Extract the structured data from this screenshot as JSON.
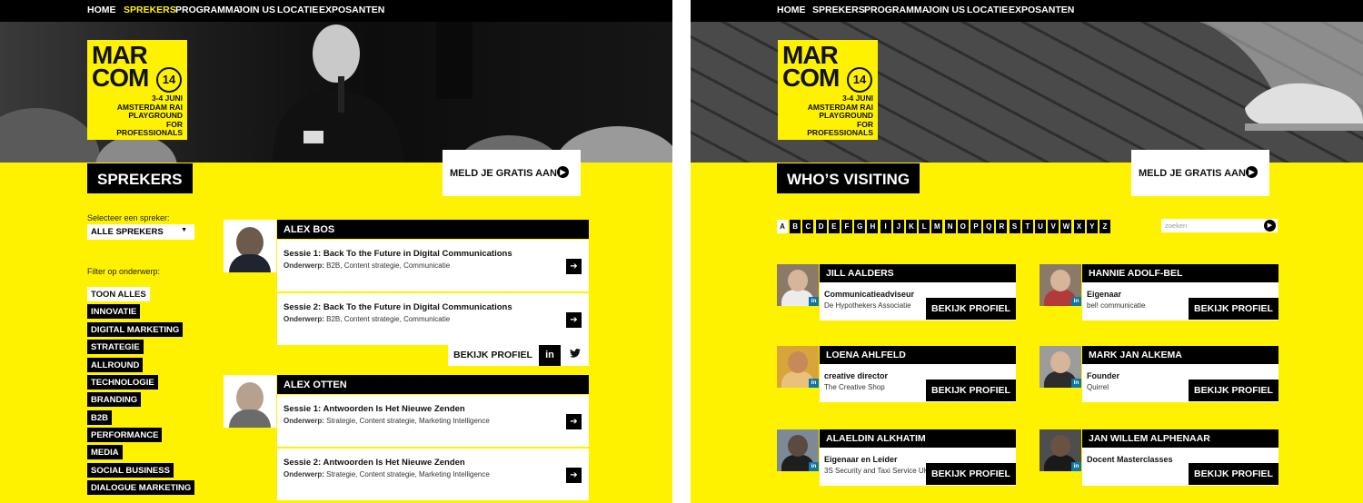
{
  "nav": [
    "HOME",
    "SPREKERS",
    "PROGRAMMA",
    "JOIN US",
    "LOCATIE",
    "EXPOSANTEN"
  ],
  "logo": {
    "line1": "MAR",
    "line2": "COM",
    "edition": "14",
    "dates": "3-4 JUNI",
    "venue": "AMSTERDAM RAI",
    "tag1": "PLAYGROUND",
    "tag2": "FOR",
    "tag3": "PROFESSIONALS"
  },
  "cta_label": "MELD JE GRATIS AAN",
  "left": {
    "title": "SPREKERS",
    "select_label": "Selecteer een spreker:",
    "select_value": "ALLE SPREKERS",
    "filter_label": "Filter op onderwerp:",
    "filters": [
      "TOON ALLES",
      "INNOVATIE",
      "DIGITAL MARKETING",
      "STRATEGIE",
      "ALLROUND",
      "TECHNOLOGIE",
      "BRANDING",
      "B2B",
      "PERFORMANCE",
      "MEDIA",
      "SOCIAL BUSINESS",
      "DIALOGUE MARKETING"
    ],
    "subject_prefix": "Onderwerp:",
    "speakers": [
      {
        "name": "ALEX BOS",
        "sessions": [
          {
            "title": "Sessie 1: Back To the Future in Digital Communications",
            "subjects": "B2B, Content strategie, Communicatie"
          },
          {
            "title": "Sessie 2: Back To the Future in Digital Communications",
            "subjects": "B2B, Content strategie, Communicatie"
          }
        ]
      },
      {
        "name": "ALEX OTTEN",
        "sessions": [
          {
            "title": "Sessie 1: Antwoorden Is Het Nieuwe Zenden",
            "subjects": "Strategie, Content strategie, Marketing Intelligence"
          },
          {
            "title": "Sessie 2: Antwoorden Is Het Nieuwe Zenden",
            "subjects": "Strategie, Content strategie, Marketing Intelligence"
          }
        ]
      }
    ],
    "profile_label": "BEKIJK PROFIEL",
    "linkedin_label": "in"
  },
  "right": {
    "title": "WHO’S VISITING",
    "letters": [
      "A",
      "B",
      "C",
      "D",
      "E",
      "F",
      "G",
      "H",
      "I",
      "J",
      "K",
      "L",
      "M",
      "N",
      "O",
      "P",
      "Q",
      "R",
      "S",
      "T",
      "U",
      "V",
      "W",
      "X",
      "Y",
      "Z"
    ],
    "search_placeholder": "zoeken",
    "linkedin_label": "in",
    "profile_label": "BEKIJK PROFIEL",
    "visitors": [
      {
        "name": "JILL AALDERS",
        "role": "Communicatieadviseur",
        "org": "De Hypothekers Associatie"
      },
      {
        "name": "HANNIE ADOLF-BEL",
        "role": "Eigenaar",
        "org": "bel! communicatie"
      },
      {
        "name": "LOENA AHLFELD",
        "role": "creative director",
        "org": "The Creative Shop"
      },
      {
        "name": "MARK JAN ALKEMA",
        "role": "Founder",
        "org": "Quirrel"
      },
      {
        "name": "ALAELDIN ALKHATIM",
        "role": "Eigenaar en Leider",
        "org": "3S Security and Taxi Service UK"
      },
      {
        "name": "JAN WILLEM ALPHENAAR",
        "role": "Docent Masterclasses",
        "org": ""
      }
    ]
  },
  "colors": {
    "accent": "#fff200",
    "dark": "#000000",
    "linkedin": "#0e76a8"
  }
}
